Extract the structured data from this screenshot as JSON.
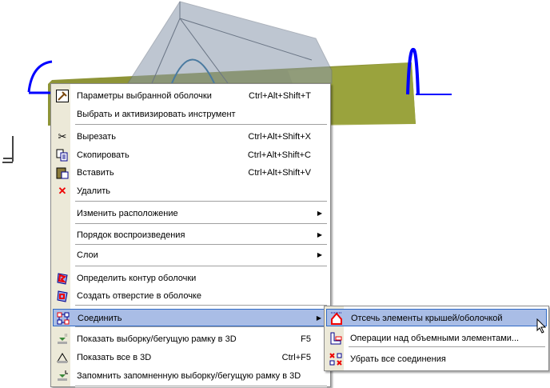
{
  "context_menu": {
    "items": [
      {
        "label": "Параметры выбранной оболочки",
        "shortcut": "Ctrl+Alt+Shift+T",
        "icon": "shell-settings-icon"
      },
      {
        "label": "Выбрать и активизировать инструмент"
      },
      {
        "label": "Вырезать",
        "shortcut": "Ctrl+Alt+Shift+X",
        "icon": "scissors-icon"
      },
      {
        "label": "Скопировать",
        "shortcut": "Ctrl+Alt+Shift+C",
        "icon": "copy-icon"
      },
      {
        "label": "Вставить",
        "shortcut": "Ctrl+Alt+Shift+V",
        "icon": "paste-icon"
      },
      {
        "label": "Удалить",
        "icon": "delete-icon"
      },
      {
        "label": "Изменить расположение",
        "submenu": true
      },
      {
        "label": "Порядок воспроизведения",
        "submenu": true
      },
      {
        "label": "Слои",
        "submenu": true
      },
      {
        "label": "Определить контур оболочки",
        "icon": "shell-contour-icon"
      },
      {
        "label": "Создать отверстие в оболочке",
        "icon": "shell-hole-icon"
      },
      {
        "label": "Соединить",
        "submenu": true,
        "icon": "connect-icon",
        "highlighted": true
      },
      {
        "label": "Показать выборку/бегущую рамку в 3D",
        "shortcut": "F5",
        "icon": "show-3d-selection-icon"
      },
      {
        "label": "Показать все в 3D",
        "shortcut": "Ctrl+F5",
        "icon": "show-all-3d-icon"
      },
      {
        "label": "Запомнить запомненную выборку/бегущую рамку в 3D",
        "icon": "remember-3d-selection-icon"
      }
    ]
  },
  "submenu": {
    "items": [
      {
        "label": "Отсечь элементы крышей/оболочкой",
        "icon": "trim-roof-icon",
        "highlighted": true
      },
      {
        "label": "Операции над объемными элементами...",
        "icon": "solid-operations-icon"
      },
      {
        "label": "Убрать все соединения",
        "icon": "remove-connections-icon"
      }
    ]
  },
  "colors": {
    "highlight": "#a9bde6",
    "highlight_border": "#316ac5",
    "shell": "#8f9a3a",
    "selection": "#0000ff"
  }
}
